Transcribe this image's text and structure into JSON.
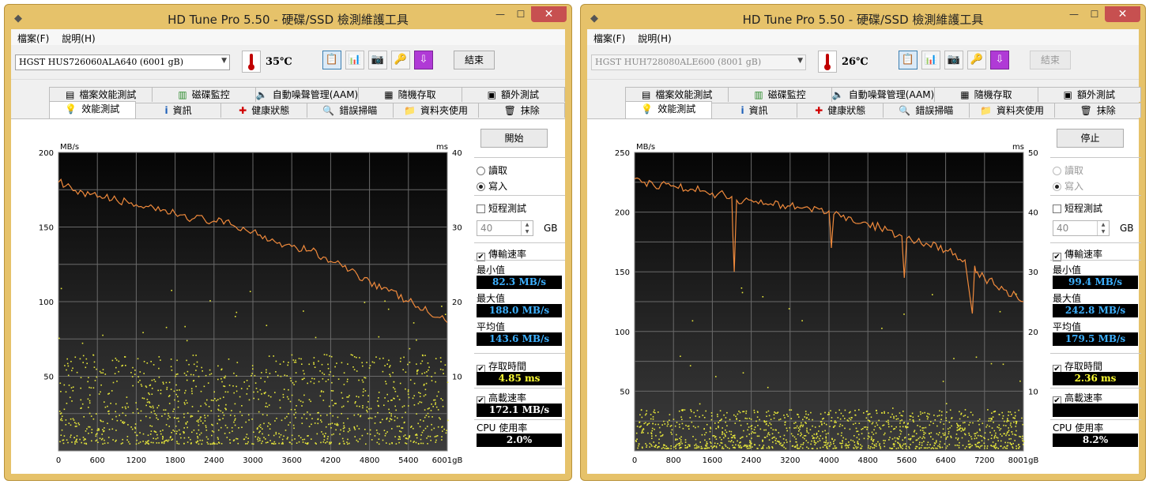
{
  "windows": [
    {
      "title": "HD Tune Pro 5.50 - 硬碟/SSD 檢測維護工具",
      "menu": [
        "檔案(F)",
        "說明(H)"
      ],
      "drive": "HGST HUS726060ALA640 (6001 gB)",
      "temperature": "35℃",
      "exit_label": "結束",
      "tabs_row1": [
        "檔案效能測試",
        "磁碟監控",
        "自動噪聲管理(AAM)",
        "隨機存取",
        "額外測試"
      ],
      "tabs_row2": [
        "效能測試",
        "資訊",
        "健康狀態",
        "錯誤掃瞄",
        "資料夾使用",
        "抹除"
      ],
      "active_tab": "效能測試",
      "start_label": "開始",
      "radio_read": "讀取",
      "radio_write": "寫入",
      "mode": "write",
      "short_test_label": "短程測試",
      "short_test_value": "40",
      "gb_label": "GB",
      "transfer_label": "傳輸速率",
      "min_label": "最小值",
      "min_value": "82.3 MB/s",
      "max_label": "最大值",
      "max_value": "188.0 MB/s",
      "avg_label": "平均值",
      "avg_value": "143.6 MB/s",
      "access_label": "存取時間",
      "access_value": "4.85 ms",
      "burst_label": "高載速率",
      "burst_value": "172.1 MB/s",
      "cpu_label": "CPU 使用率",
      "cpu_value": "2.0%",
      "chart_data": {
        "type": "line",
        "ylabel_left": "MB/s",
        "ylabel_right": "ms",
        "ylim_left": [
          0,
          200
        ],
        "ylim_right": [
          0,
          40
        ],
        "yticks_left": [
          "50",
          "100",
          "150",
          "200"
        ],
        "yticks_right": [
          "10",
          "20",
          "30",
          "40"
        ],
        "xlim": [
          0,
          6001
        ],
        "xticks": [
          "0",
          "600",
          "1200",
          "1800",
          "2400",
          "3000",
          "3600",
          "4200",
          "4800",
          "5400",
          "6001gB"
        ],
        "series": [
          {
            "values_x": [
              0,
              300,
              600,
              900,
              1200,
              1500,
              1800,
              2100,
              2400,
              2700,
              3000,
              3300,
              3600,
              3900,
              4200,
              4500,
              4800,
              5100,
              5400,
              5700,
              6001
            ],
            "values_y": [
              180,
              172,
              170,
              168,
              165,
              161,
              159,
              156,
              154,
              151,
              147,
              142,
              137,
              134,
              127,
              121,
              114,
              107,
              100,
              93,
              86
            ]
          }
        ],
        "access_time_ms_band": [
          1,
          13
        ]
      }
    },
    {
      "title": "HD Tune Pro 5.50 - 硬碟/SSD 檢測維護工具",
      "menu": [
        "檔案(F)",
        "說明(H)"
      ],
      "drive": "HGST HUH728080ALE600 (8001 gB)",
      "temperature": "26℃",
      "exit_label": "結束",
      "tabs_row1": [
        "檔案效能測試",
        "磁碟監控",
        "自動噪聲管理(AAM)",
        "隨機存取",
        "額外測試"
      ],
      "tabs_row2": [
        "效能測試",
        "資訊",
        "健康狀態",
        "錯誤掃瞄",
        "資料夾使用",
        "抹除"
      ],
      "active_tab": "效能測試",
      "start_label": "停止",
      "radio_read": "讀取",
      "radio_write": "寫入",
      "mode": "write",
      "short_test_label": "短程測試",
      "short_test_value": "40",
      "gb_label": "GB",
      "transfer_label": "傳輸速率",
      "min_label": "最小值",
      "min_value": "99.4 MB/s",
      "max_label": "最大值",
      "max_value": "242.8 MB/s",
      "avg_label": "平均值",
      "avg_value": "179.5 MB/s",
      "access_label": "存取時間",
      "access_value": "2.36 ms",
      "burst_label": "高載速率",
      "burst_value": "",
      "cpu_label": "CPU 使用率",
      "cpu_value": "8.2%",
      "chart_data": {
        "type": "line",
        "ylabel_left": "MB/s",
        "ylabel_right": "ms",
        "ylim_left": [
          0,
          250
        ],
        "ylim_right": [
          0,
          50
        ],
        "yticks_left": [
          "50",
          "100",
          "150",
          "200",
          "250"
        ],
        "yticks_right": [
          "10",
          "20",
          "30",
          "40",
          "50"
        ],
        "xlim": [
          0,
          8001
        ],
        "xticks": [
          "0",
          "800",
          "1600",
          "2400",
          "3200",
          "4000",
          "4800",
          "5600",
          "6400",
          "7200",
          "8001gB"
        ],
        "series": [
          {
            "values_x": [
              0,
              400,
              800,
              1200,
              1600,
              2000,
              2050,
              2100,
              2400,
              2800,
              3200,
              3600,
              4000,
              4050,
              4100,
              4400,
              4800,
              5200,
              5500,
              5550,
              5600,
              6000,
              6400,
              6800,
              6950,
              7000,
              7050,
              7200,
              7600,
              8001
            ],
            "values_y": [
              228,
              222,
              222,
              219,
              216,
              213,
              150,
              210,
              210,
              207,
              205,
              203,
              201,
              170,
              198,
              196,
              190,
              185,
              180,
              145,
              178,
              174,
              168,
              160,
              115,
              155,
              150,
              145,
              135,
              125
            ]
          }
        ],
        "access_time_ms_band": [
          0.5,
          7
        ]
      }
    }
  ]
}
